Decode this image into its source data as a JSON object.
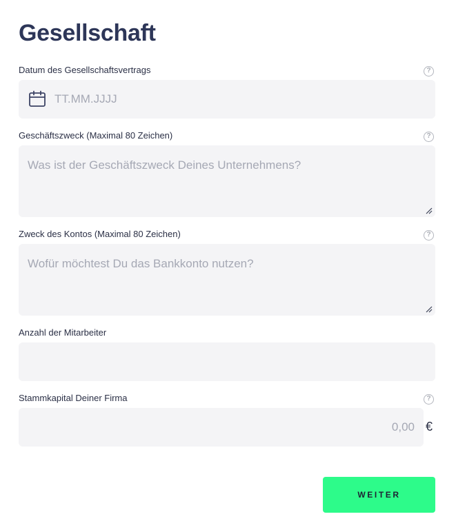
{
  "page": {
    "title": "Gesellschaft"
  },
  "form": {
    "contract_date": {
      "label": "Datum des Gesellschaftsvertrags",
      "placeholder": "TT.MM.JJJJ",
      "value": "",
      "icon": "calendar-icon",
      "help_icon": "question-circle-icon"
    },
    "business_purpose": {
      "label": "Geschäftszweck (Maximal 80 Zeichen)",
      "placeholder": "Was ist der Geschäftszweck Deines Unternehmens?",
      "value": "",
      "help_icon": "question-circle-icon"
    },
    "account_purpose": {
      "label": "Zweck des Kontos (Maximal 80 Zeichen)",
      "placeholder": "Wofür möchtest Du das Bankkonto nutzen?",
      "value": "",
      "help_icon": "question-circle-icon"
    },
    "employee_count": {
      "label": "Anzahl der Mitarbeiter",
      "placeholder": "",
      "value": ""
    },
    "share_capital": {
      "label": "Stammkapital Deiner Firma",
      "placeholder": "0,00",
      "value": "",
      "currency": "€",
      "help_icon": "question-circle-icon"
    }
  },
  "actions": {
    "next_label": "WEITER"
  },
  "colors": {
    "title": "#2d3658",
    "field_background": "#f4f4f6",
    "button_background": "#2dfb8a",
    "help_icon": "#b2b5bd"
  }
}
